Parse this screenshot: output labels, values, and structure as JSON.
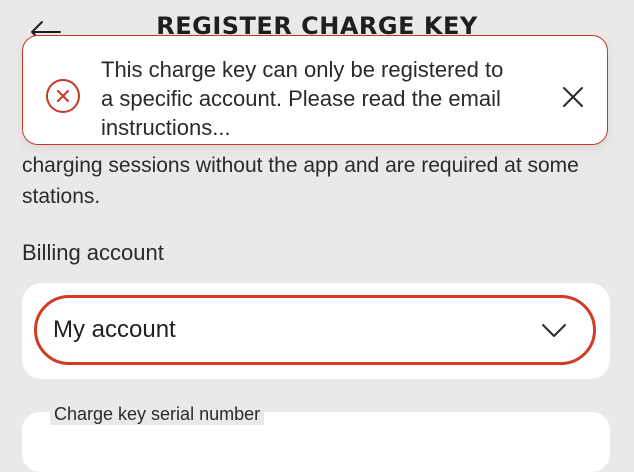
{
  "header": {
    "title": "REGISTER CHARGE KEY",
    "back_icon": "arrow-left-icon"
  },
  "toast": {
    "message": "This charge key can only be registered to a specific account. Please read the email instructions...",
    "error_icon": "error-circle-icon",
    "close_icon": "close-icon",
    "accent_color": "#c8372a"
  },
  "description": {
    "text": "charging sessions without the app and are required at some stations."
  },
  "billing": {
    "label": "Billing account",
    "selected_value": "My account",
    "chevron_icon": "chevron-down-icon",
    "highlight_color": "#d43a23"
  },
  "serial": {
    "label": "Charge key serial number"
  }
}
